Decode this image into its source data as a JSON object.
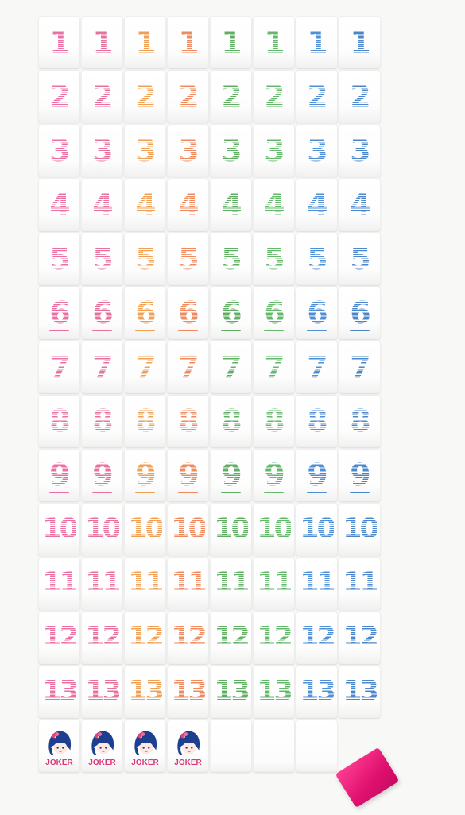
{
  "colors": {
    "columns": [
      "#ec6fa3",
      "#e8709c",
      "#f0a055",
      "#ef8a5e",
      "#5fae62",
      "#63b86a",
      "#4f8fd4",
      "#4b86c9"
    ],
    "joker_text": "#d8377a",
    "rack": "#ec1a7e"
  },
  "rows": [
    {
      "number": "1",
      "underline": false
    },
    {
      "number": "2",
      "underline": false
    },
    {
      "number": "3",
      "underline": false
    },
    {
      "number": "4",
      "underline": false
    },
    {
      "number": "5",
      "underline": false
    },
    {
      "number": "6",
      "underline": true
    },
    {
      "number": "7",
      "underline": false
    },
    {
      "number": "8",
      "underline": false
    },
    {
      "number": "9",
      "underline": true
    },
    {
      "number": "10",
      "underline": false
    },
    {
      "number": "11",
      "underline": false
    },
    {
      "number": "12",
      "underline": false
    },
    {
      "number": "13",
      "underline": false
    }
  ],
  "joker_row": {
    "joker_label": "JOKER",
    "joker_count": 4,
    "blank_count": 3,
    "icon": "joker-face-icon"
  },
  "rack_icon": "pink-tile-rack"
}
